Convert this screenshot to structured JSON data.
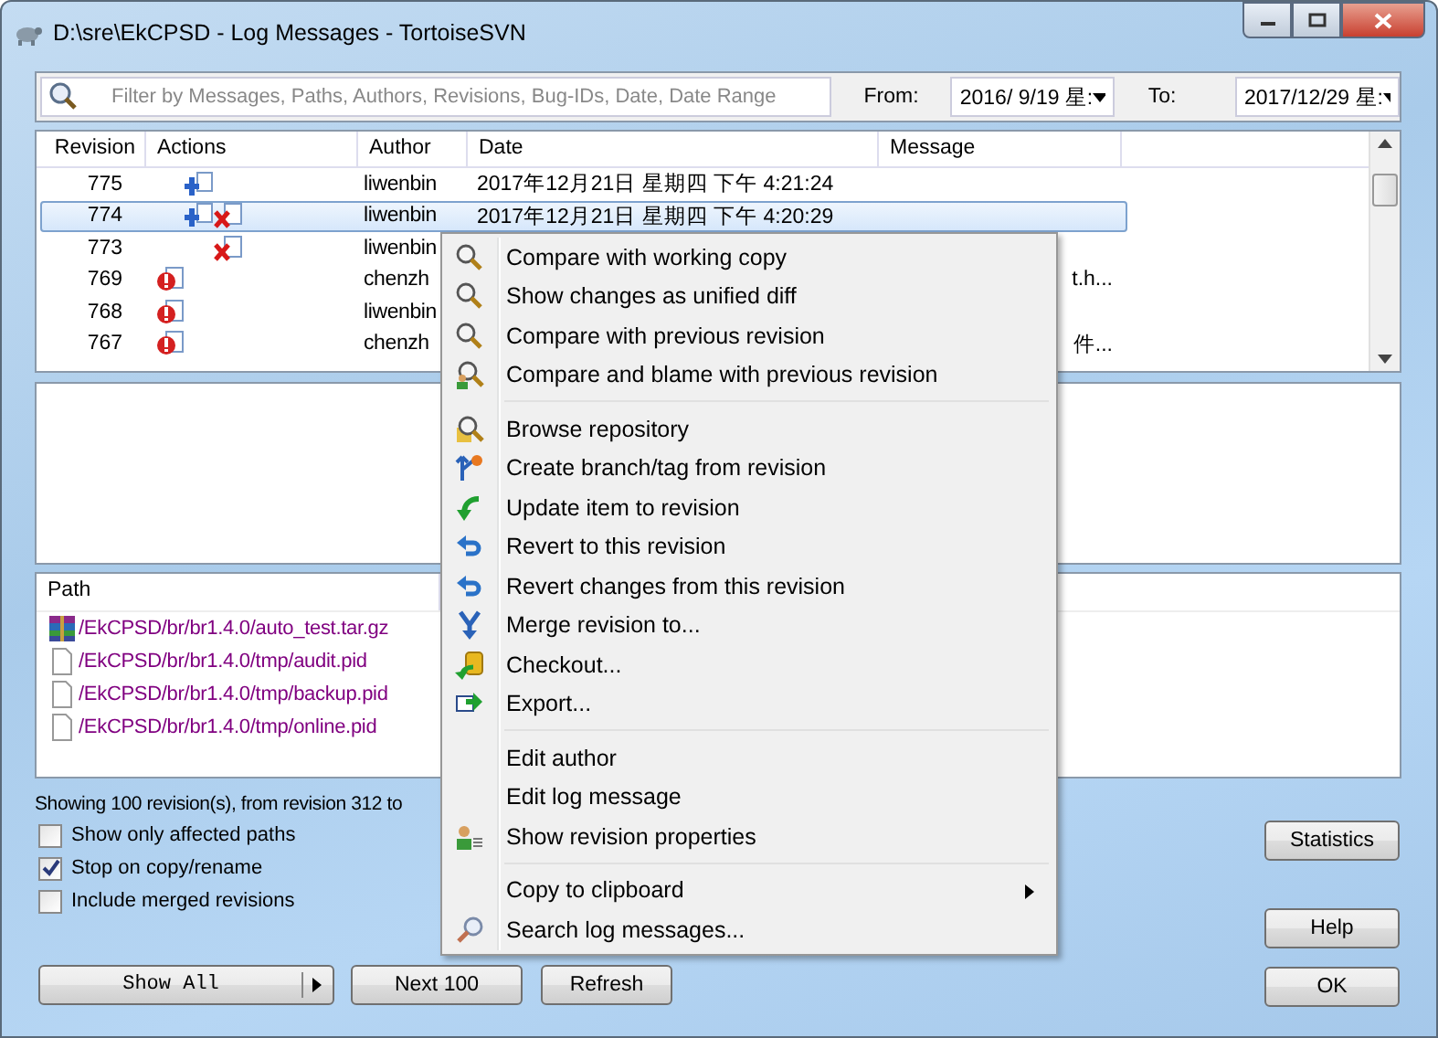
{
  "window": {
    "title": "D:\\sre\\EkCPSD - Log Messages - TortoiseSVN"
  },
  "filter": {
    "placeholder": "Filter by Messages, Paths, Authors, Revisions, Bug-IDs, Date, Date Range",
    "from_label": "From:",
    "from_value": "2016/  9/19 星:",
    "to_label": "To:",
    "to_value": "2017/12/29 星:"
  },
  "log": {
    "columns": [
      "Revision",
      "Actions",
      "Author",
      "Date",
      "Message"
    ],
    "rows": [
      {
        "revision": "775",
        "actions": [
          {
            "kind": "added"
          }
        ],
        "author": "liwenbin",
        "date": "2017年12月21日 星期四 下午 4:21:24",
        "message": "",
        "selected": false
      },
      {
        "revision": "774",
        "actions": [
          {
            "kind": "added"
          },
          {
            "kind": "deleted"
          }
        ],
        "author": "liwenbin",
        "date": "2017年12月21日 星期四 下午 4:20:29",
        "message": "",
        "selected": true
      },
      {
        "revision": "773",
        "actions": [
          {
            "kind": "deleted"
          }
        ],
        "author": "liwenbin",
        "date": "",
        "message": "",
        "selected": false
      },
      {
        "revision": "769",
        "actions": [
          {
            "kind": "replaced"
          }
        ],
        "author": "chenzh",
        "date": "",
        "message": "t.h...",
        "selected": false
      },
      {
        "revision": "768",
        "actions": [
          {
            "kind": "replaced"
          }
        ],
        "author": "liwenbin",
        "date": "",
        "message": "",
        "selected": false
      },
      {
        "revision": "767",
        "actions": [
          {
            "kind": "replaced"
          }
        ],
        "author": "chenzh",
        "date": "",
        "message": "件...",
        "selected": false
      }
    ]
  },
  "paths": {
    "column": "Path",
    "items": [
      {
        "kind": "archive",
        "path": "/EkCPSD/br/br1.4.0/auto_test.tar.gz"
      },
      {
        "kind": "file",
        "path": "/EkCPSD/br/br1.4.0/tmp/audit.pid"
      },
      {
        "kind": "file",
        "path": "/EkCPSD/br/br1.4.0/tmp/backup.pid"
      },
      {
        "kind": "file",
        "path": "/EkCPSD/br/br1.4.0/tmp/online.pid"
      }
    ]
  },
  "status": "Showing 100 revision(s), from revision 312 to",
  "options": [
    {
      "label": "Show only affected paths",
      "checked": false
    },
    {
      "label": "Stop on copy/rename",
      "checked": true
    },
    {
      "label": "Include merged revisions",
      "checked": false
    }
  ],
  "buttons": {
    "show_all": "Show All",
    "next": "Next 100",
    "refresh": "Refresh",
    "statistics": "Statistics",
    "help": "Help",
    "ok": "OK"
  },
  "context_menu": [
    {
      "kind": "compare",
      "label": "Compare with working copy",
      "submenu": false,
      "separator_after": false
    },
    {
      "kind": "compare",
      "label": "Show changes as unified diff",
      "submenu": false,
      "separator_after": false
    },
    {
      "kind": "compare",
      "label": "Compare with previous revision",
      "submenu": false,
      "separator_after": false
    },
    {
      "kind": "blame",
      "label": "Compare and blame with previous revision",
      "submenu": false,
      "separator_after": true
    },
    {
      "kind": "browse",
      "label": "Browse repository",
      "submenu": false,
      "separator_after": false
    },
    {
      "kind": "branch",
      "label": "Create branch/tag from revision",
      "submenu": false,
      "separator_after": false
    },
    {
      "kind": "update",
      "label": "Update item to revision",
      "submenu": false,
      "separator_after": false
    },
    {
      "kind": "revert",
      "label": "Revert to this revision",
      "submenu": false,
      "separator_after": false
    },
    {
      "kind": "revert",
      "label": "Revert changes from this revision",
      "submenu": false,
      "separator_after": false
    },
    {
      "kind": "merge",
      "label": "Merge revision to...",
      "submenu": false,
      "separator_after": false
    },
    {
      "kind": "checkout",
      "label": "Checkout...",
      "submenu": false,
      "separator_after": false
    },
    {
      "kind": "export",
      "label": "Export...",
      "submenu": false,
      "separator_after": true
    },
    {
      "kind": "plain",
      "label": "Edit author",
      "submenu": false,
      "separator_after": false
    },
    {
      "kind": "plain",
      "label": "Edit log message",
      "submenu": false,
      "separator_after": false
    },
    {
      "kind": "properties",
      "label": "Show revision properties",
      "submenu": false,
      "separator_after": true
    },
    {
      "kind": "plain",
      "label": "Copy to clipboard",
      "submenu": true,
      "separator_after": false
    },
    {
      "kind": "search",
      "label": "Search log messages...",
      "submenu": false,
      "separator_after": false
    }
  ]
}
